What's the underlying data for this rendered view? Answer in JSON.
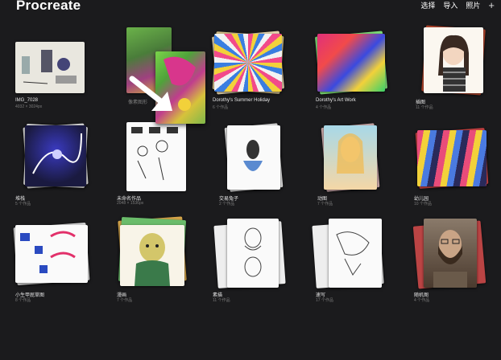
{
  "app": {
    "title": "Procreate",
    "actions": {
      "select": "选择",
      "import": "导入",
      "photos": "照片",
      "add": "+"
    }
  },
  "items": [
    {
      "label": "IMG_7028",
      "sub": "4032 × 3024px"
    },
    {
      "label": "像素图形",
      "sub": ""
    },
    {
      "label": "Dorothy's Summer Holiday",
      "sub": "6 个作品"
    },
    {
      "label": "Dorothy's Art Work",
      "sub": "4 个作品"
    },
    {
      "label": "插图",
      "sub": "11 个作品"
    },
    {
      "label": "堆栈",
      "sub": "5 个作品"
    },
    {
      "label": "未命名作品",
      "sub": "2048 × 1536px"
    },
    {
      "label": "交易兔子",
      "sub": "2 个作品"
    },
    {
      "label": "动图",
      "sub": "7 个作品"
    },
    {
      "label": "幼儿园",
      "sub": "10 个作品"
    },
    {
      "label": "小生甲屁草图",
      "sub": "8 个作品"
    },
    {
      "label": "漫画",
      "sub": "7 个作品"
    },
    {
      "label": "素描",
      "sub": "11 个作品"
    },
    {
      "label": "速写",
      "sub": "17 个作品"
    },
    {
      "label": "随机图",
      "sub": "4 个作品"
    }
  ]
}
